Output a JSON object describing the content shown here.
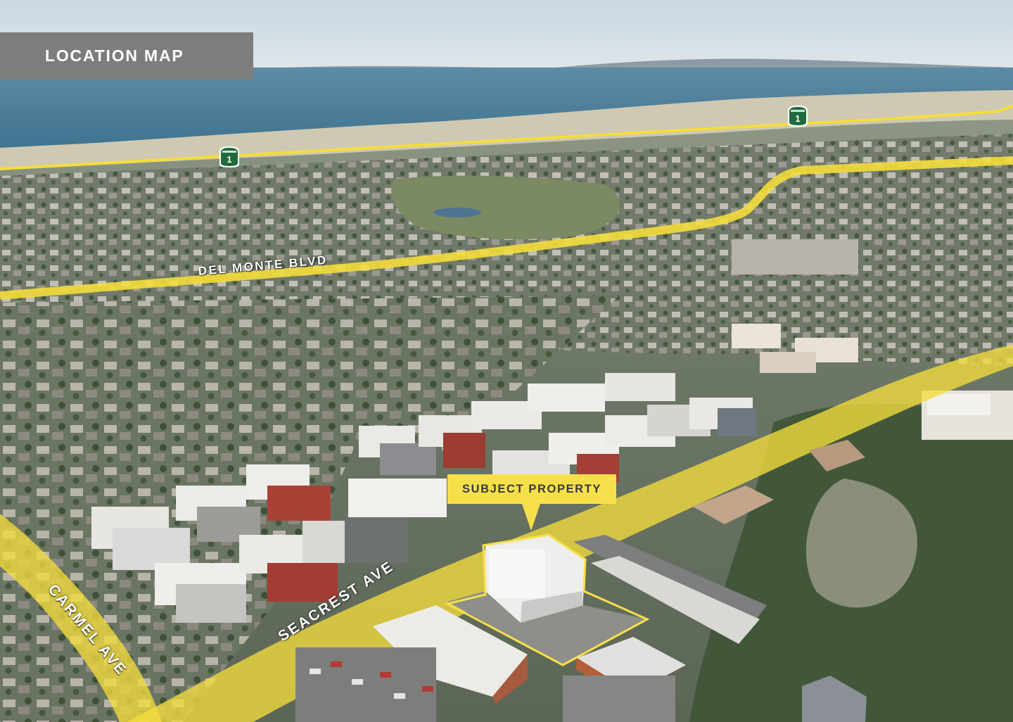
{
  "map": {
    "title": "LOCATION MAP",
    "callout_label": "SUBJECT PROPERTY",
    "roads": {
      "del_monte": "DEL MONTE BLVD",
      "seacrest": "SEACREST AVE",
      "carmel": "CARMEL AVE"
    },
    "highway_shields": [
      {
        "route": "1"
      },
      {
        "route": "1"
      }
    ]
  },
  "colors": {
    "road_highlight": "#f4dd3c",
    "callout_fill": "#f6e04a",
    "banner_fill": "#7d7d7d",
    "shield_green": "#1f6b3a",
    "ocean": "#4f7f9a"
  }
}
